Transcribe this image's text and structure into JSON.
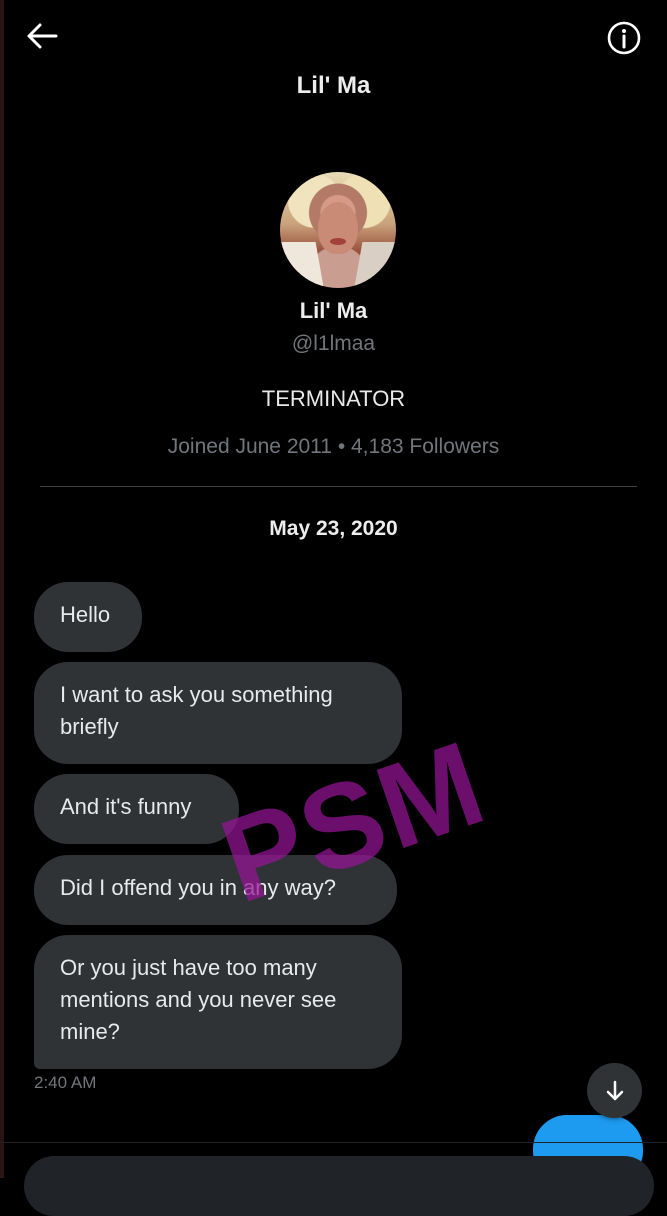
{
  "header": {
    "title": "Lil' Ma",
    "back_icon": "arrow-left-icon",
    "info_icon": "info-icon"
  },
  "profile": {
    "name": "Lil' Ma",
    "handle": "@l1lmaa",
    "bio": "TERMINATOR",
    "meta": "Joined June 2011 • 4,183 Followers"
  },
  "conversation": {
    "date": "May 23, 2020",
    "messages": [
      {
        "text": "Hello"
      },
      {
        "text": "I want to ask you something briefly"
      },
      {
        "text": "And it's funny"
      },
      {
        "text": "Did I offend you in any way?"
      },
      {
        "text": "Or you just have too many mentions and you never see mine?"
      }
    ],
    "timestamp": "2:40 AM"
  },
  "watermark": "PSM",
  "scroll_icon": "arrow-down-icon",
  "colors": {
    "background": "#000000",
    "bubble_received": "#2f3336",
    "bubble_sent": "#1d9bf0",
    "secondary_text": "#71767b",
    "watermark": "#961496"
  }
}
